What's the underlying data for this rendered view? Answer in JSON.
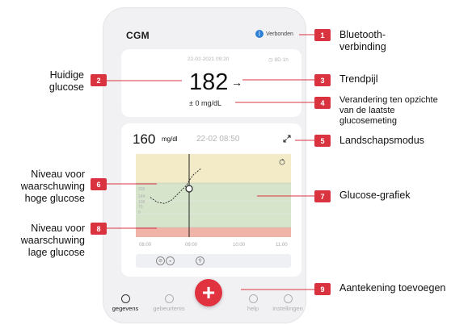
{
  "app": {
    "title": "CGM"
  },
  "bluetooth": {
    "status": "Verbonden",
    "icon": "bluetooth-icon"
  },
  "current": {
    "date": "22-02-2021 09:20",
    "duration": "8D 1h",
    "value": "182",
    "trend": "→",
    "delta": "± 0 mg/dL"
  },
  "graph_card": {
    "value": "160",
    "unit": "mg/dl",
    "time": "22-02 08:50"
  },
  "chart_data": {
    "type": "line",
    "x_ticks": [
      "08:00",
      "09:00",
      "10:00",
      "11:00"
    ],
    "y_ticks": [
      "200",
      "144",
      "108",
      "70",
      "0"
    ],
    "high_alert_level": 144,
    "low_alert_level": 70,
    "series": [
      {
        "x": [
          "08:05",
          "08:15",
          "08:25",
          "08:35",
          "08:45",
          "08:55",
          "09:00",
          "09:05",
          "09:15"
        ],
        "values": [
          120,
          112,
          110,
          116,
          128,
          140,
          150,
          158,
          168
        ]
      }
    ]
  },
  "tabs": [
    {
      "label": "gegevens",
      "active": true,
      "icon": "drop-icon"
    },
    {
      "label": "gebeurtenis",
      "active": false,
      "icon": "event-icon"
    },
    {
      "label": "help",
      "active": false,
      "icon": "heart-icon"
    },
    {
      "label": "instellingen",
      "active": false,
      "icon": "settings-icon"
    }
  ],
  "callouts": [
    {
      "num": "1",
      "label": "Bluetooth-\nverbinding"
    },
    {
      "num": "2",
      "label": "Huidige\nglucose"
    },
    {
      "num": "3",
      "label": "Trendpijl"
    },
    {
      "num": "4",
      "label": "Verandering ten opzichte\nvan de laatste\nglucosemeting"
    },
    {
      "num": "5",
      "label": "Landschapsmodus"
    },
    {
      "num": "6",
      "label": "Niveau voor\nwaarschuwing\nhoge glucose"
    },
    {
      "num": "7",
      "label": "Glucose-grafiek"
    },
    {
      "num": "8",
      "label": "Niveau voor\nwaarschuwing\nlage glucose"
    },
    {
      "num": "9",
      "label": "Aantekening toevoegen"
    }
  ],
  "colors": {
    "accent": "#d9333f",
    "high_zone": "#f3ebc8",
    "target_zone": "#d6e4cc",
    "low_zone": "#f0b3a8",
    "bluetooth": "#2d7fd6"
  }
}
